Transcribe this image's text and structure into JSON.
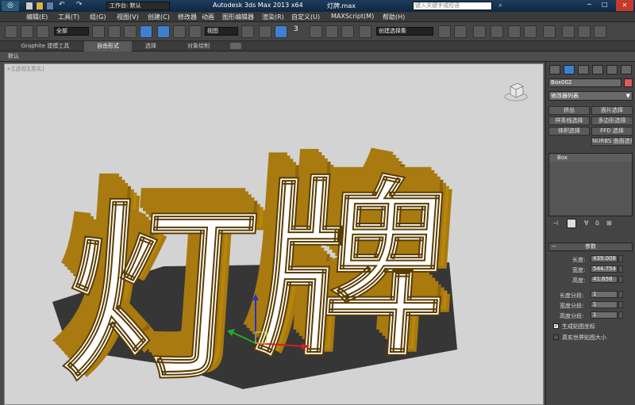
{
  "titlebar": {
    "workspace_label": "工作台: 默认",
    "app_title": "Autodesk 3ds Max  2013 x64",
    "file_name": "灯牌.max",
    "search_placeholder": "键入关键字或短语"
  },
  "menu": {
    "items": [
      "编辑(E)",
      "工具(T)",
      "组(G)",
      "视图(V)",
      "创建(C)",
      "修改器",
      "动画",
      "图形编辑器",
      "渲染(R)",
      "自定义(U)",
      "MAXScript(M)",
      "帮助(H)"
    ]
  },
  "toolbar": {
    "selection_filter": "全部",
    "ref_coord": "视图",
    "named_selection": "创建选择集",
    "snap_label": "3"
  },
  "ribbon": {
    "tabs": [
      "Graphite 建模工具",
      "自由形式",
      "选择",
      "对象绘制"
    ]
  },
  "ribbonbar": {
    "label": "默认"
  },
  "viewport": {
    "label": "+][透视][真实]",
    "scene_text": "灯牌",
    "face_color": "#ffffff",
    "side_color": "#a87a10",
    "background": "#d3d3d3"
  },
  "cmdpanel": {
    "object_name": "Box002",
    "object_color": "#e05a5a",
    "modifier_list": "修改器列表",
    "buttons": [
      "挤出",
      "面片选择",
      "样条线选择",
      "多边形选择",
      "体积选择",
      "FFD 选择",
      "NURBS 曲面选择"
    ],
    "stack_item": "Box",
    "rollout_title": "参数",
    "params": [
      {
        "label": "长度:",
        "value": "439.008"
      },
      {
        "label": "宽度:",
        "value": "544.754"
      },
      {
        "label": "高度:",
        "value": "41.658"
      }
    ],
    "segs": [
      {
        "label": "长度分段:",
        "value": "1"
      },
      {
        "label": "宽度分段:",
        "value": "1"
      },
      {
        "label": "高度分段:",
        "value": "1"
      }
    ],
    "chk_mapping": "生成贴图坐标",
    "chk_realworld": "真实世界贴图大小"
  }
}
